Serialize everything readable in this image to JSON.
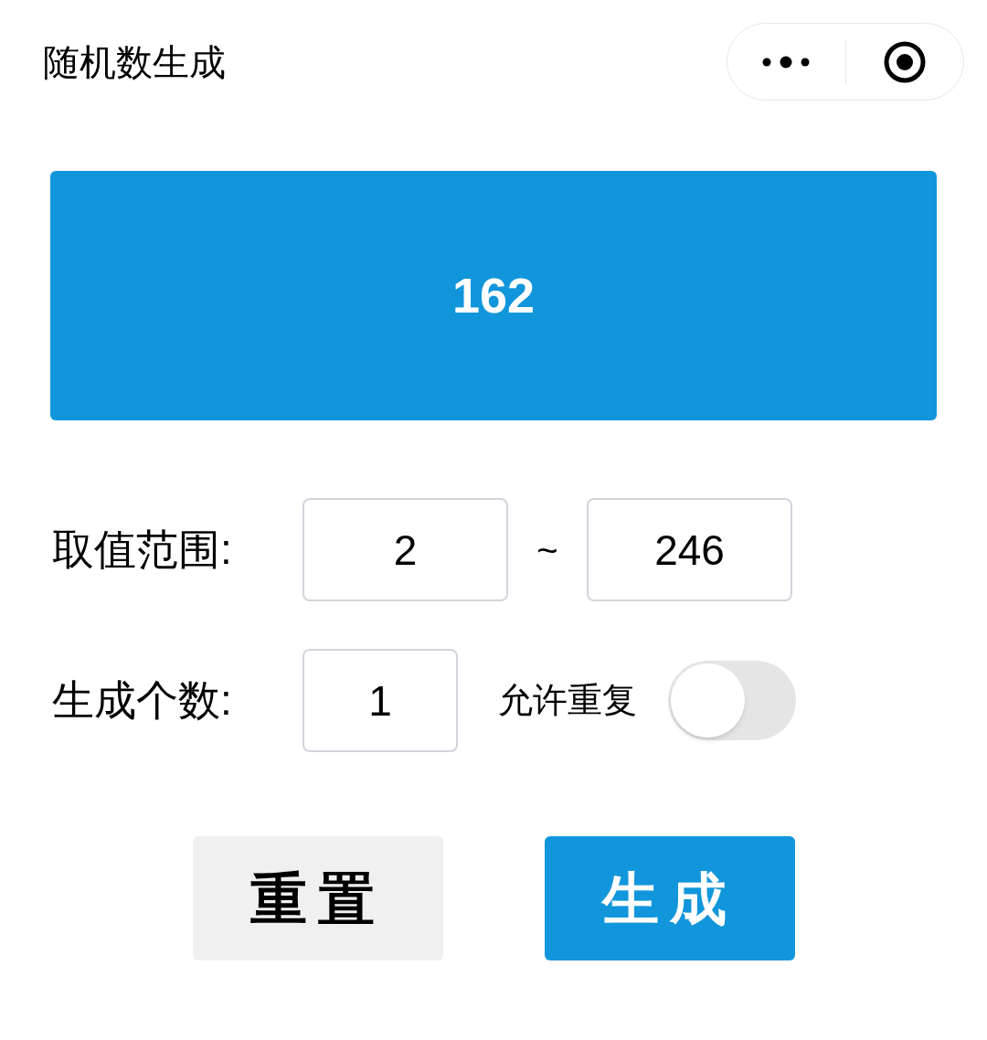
{
  "title": "随机数生成",
  "result": "162",
  "range": {
    "label": "取值范围:",
    "min": "2",
    "separator": "~",
    "max": "246"
  },
  "count": {
    "label": "生成个数:",
    "value": "1"
  },
  "allow_repeat": {
    "label": "允许重复",
    "on": false
  },
  "buttons": [
    {
      "label": "重置",
      "kind": "secondary"
    },
    {
      "label": "生成",
      "kind": "primary"
    }
  ]
}
